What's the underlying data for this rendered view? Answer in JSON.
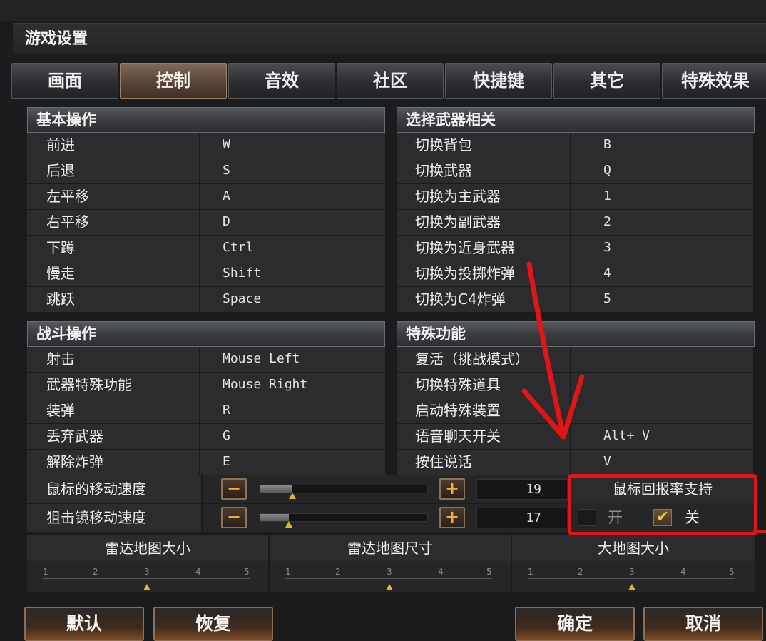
{
  "window_title": "游戏设置",
  "tabs": [
    {
      "label": "画面",
      "active": false
    },
    {
      "label": "控制",
      "active": true
    },
    {
      "label": "音效",
      "active": false
    },
    {
      "label": "社区",
      "active": false
    },
    {
      "label": "快捷键",
      "active": false
    },
    {
      "label": "其它",
      "active": false
    },
    {
      "label": "特殊效果",
      "active": false
    }
  ],
  "basic_ops": {
    "title": "基本操作",
    "rows": [
      {
        "label": "前进",
        "key": "W"
      },
      {
        "label": "后退",
        "key": "S"
      },
      {
        "label": "左平移",
        "key": "A"
      },
      {
        "label": "右平移",
        "key": "D"
      },
      {
        "label": "下蹲",
        "key": "Ctrl"
      },
      {
        "label": "慢走",
        "key": "Shift"
      },
      {
        "label": "跳跃",
        "key": "Space"
      }
    ]
  },
  "weapon_ops": {
    "title": "选择武器相关",
    "rows": [
      {
        "label": "切换背包",
        "key": "B"
      },
      {
        "label": "切换武器",
        "key": "Q"
      },
      {
        "label": "切换为主武器",
        "key": "1"
      },
      {
        "label": "切换为副武器",
        "key": "2"
      },
      {
        "label": "切换为近身武器",
        "key": "3"
      },
      {
        "label": "切换为投掷炸弹",
        "key": "4"
      },
      {
        "label": "切换为C4炸弹",
        "key": "5"
      }
    ]
  },
  "combat_ops": {
    "title": "战斗操作",
    "rows": [
      {
        "label": "射击",
        "key": "Mouse Left"
      },
      {
        "label": "武器特殊功能",
        "key": "Mouse Right"
      },
      {
        "label": "装弹",
        "key": "R"
      },
      {
        "label": "丢弃武器",
        "key": "G"
      },
      {
        "label": "解除炸弹",
        "key": "E"
      }
    ]
  },
  "special_ops": {
    "title": "特殊功能",
    "rows": [
      {
        "label": "复活（挑战模式）",
        "key": ""
      },
      {
        "label": "切换特殊道具",
        "key": ""
      },
      {
        "label": "启动特殊装置",
        "key": ""
      },
      {
        "label": "语音聊天开关",
        "key": "Alt+ V"
      },
      {
        "label": "按住说话",
        "key": "V"
      }
    ]
  },
  "speeds": [
    {
      "label": "鼠标的移动速度",
      "value": "19",
      "fraction": 0.19
    },
    {
      "label": "狙击镜移动速度",
      "value": "17",
      "fraction": 0.17
    }
  ],
  "mouse_report": {
    "title": "鼠标回报率支持",
    "on_label": "开",
    "off_label": "关",
    "selected": "off"
  },
  "radar": [
    {
      "title": "雷达地图大小",
      "ticks": [
        "1",
        "2",
        "3",
        "4",
        "5"
      ],
      "value": 3
    },
    {
      "title": "雷达地图尺寸",
      "ticks": [
        "1",
        "2",
        "3",
        "4",
        "5"
      ],
      "value": 3
    },
    {
      "title": "大地图大小",
      "ticks": [
        "1",
        "2",
        "3",
        "4",
        "5"
      ],
      "value": 3
    }
  ],
  "buttons": {
    "default": "默认",
    "restore": "恢复",
    "confirm": "确定",
    "cancel": "取消"
  },
  "colors": {
    "annotation": "#e01515",
    "accent": "#e8b030"
  }
}
